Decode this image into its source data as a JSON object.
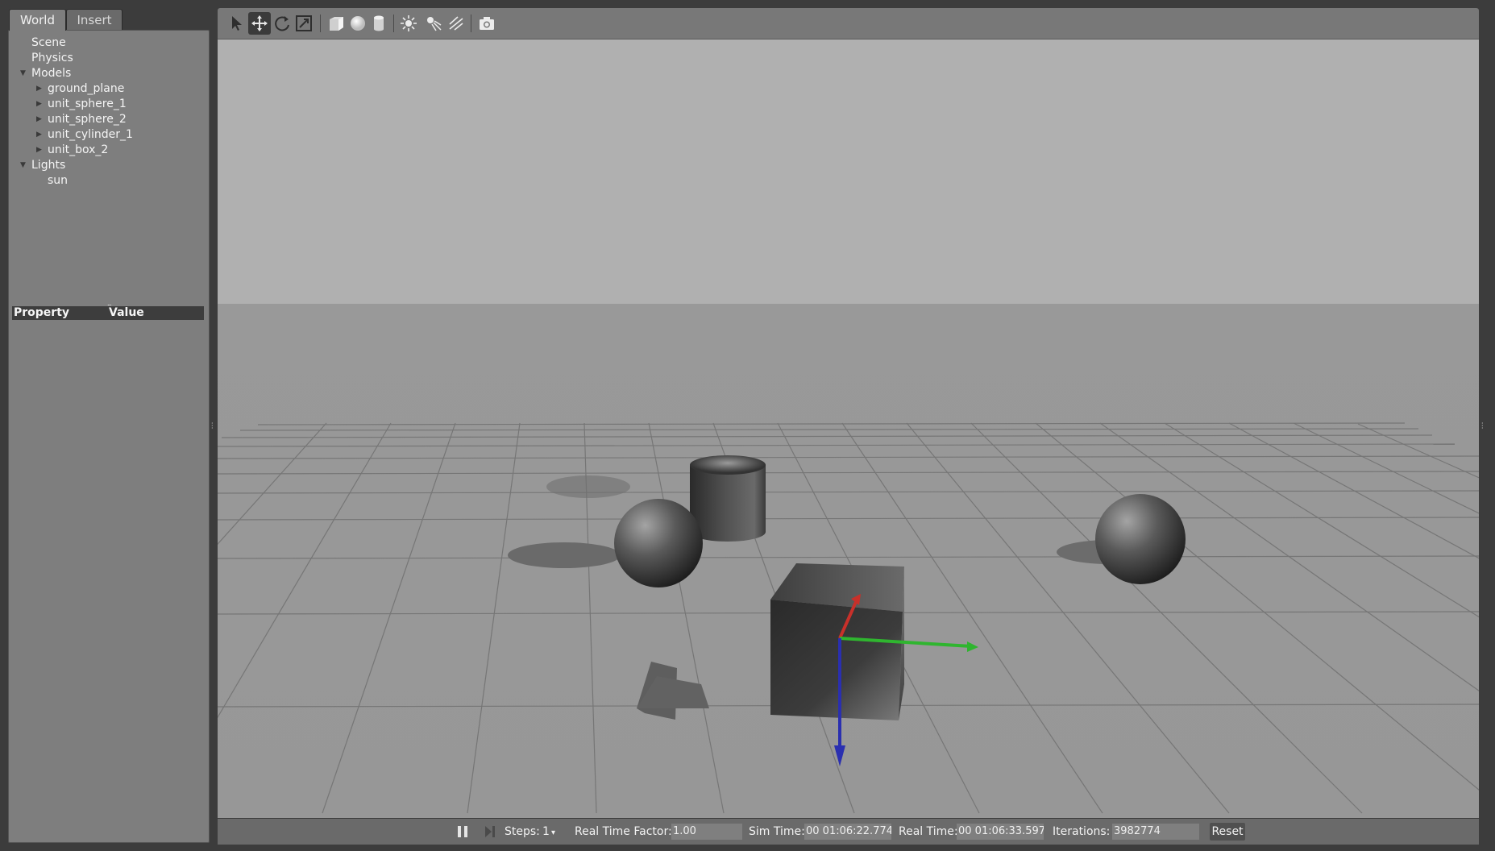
{
  "tabs": {
    "world": "World",
    "insert": "Insert"
  },
  "tree": {
    "scene": "Scene",
    "physics": "Physics",
    "models": "Models",
    "model_items": [
      "ground_plane",
      "unit_sphere_1",
      "unit_sphere_2",
      "unit_cylinder_1",
      "unit_box_2"
    ],
    "lights": "Lights",
    "light_items": [
      "sun"
    ]
  },
  "properties": {
    "property_header": "Property",
    "value_header": "Value"
  },
  "toolbar": {
    "icons": [
      "select-arrow-icon",
      "translate-icon",
      "rotate-icon",
      "scale-icon",
      "box-shape-icon",
      "sphere-shape-icon",
      "cylinder-shape-icon",
      "point-light-icon",
      "spot-light-icon",
      "directional-light-icon",
      "screenshot-camera-icon"
    ],
    "active_tool": "translate-icon"
  },
  "bottom_bar": {
    "steps_label": "Steps:",
    "steps_value": "1",
    "rtf_label": "Real Time Factor:",
    "rtf_value": "1.00",
    "sim_time_label": "Sim Time:",
    "sim_time_value": "00 01:06:22.774",
    "real_time_label": "Real Time:",
    "real_time_value": "00 01:06:33.597",
    "iterations_label": "Iterations:",
    "iterations_value": "3982774",
    "reset_label": "Reset"
  },
  "colors": {
    "sky": "#b0b0b0",
    "ground": "#999999",
    "grid": "#767676",
    "axis_x": "#c8302a",
    "axis_y": "#2fb52f",
    "axis_z": "#2a2fb0",
    "panel": "#7e7e7e",
    "toolbar": "#787878"
  }
}
